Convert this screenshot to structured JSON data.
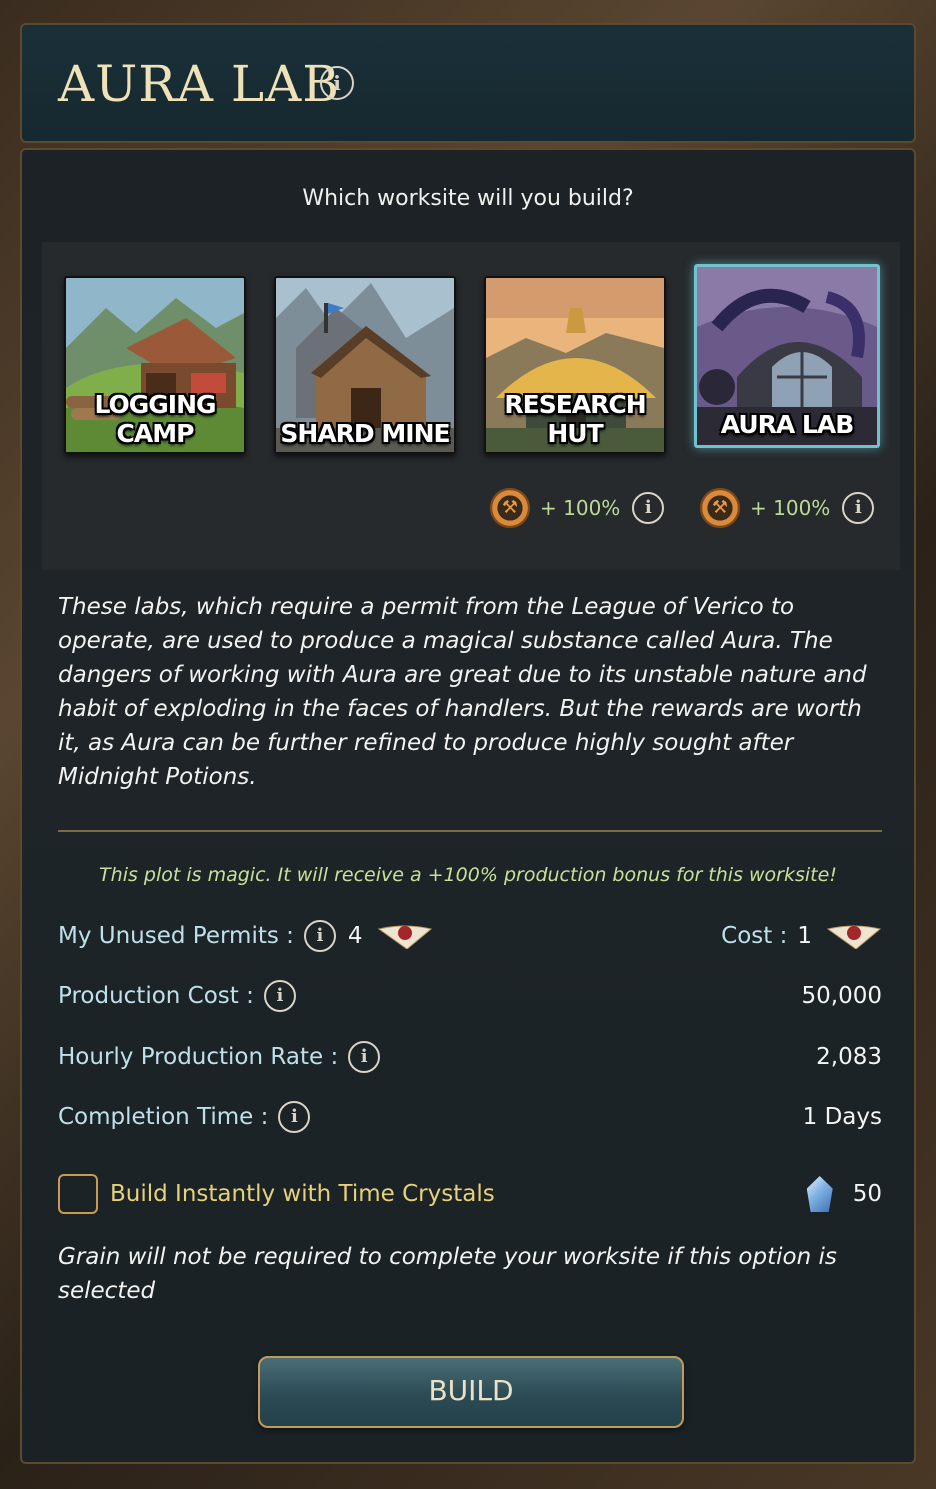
{
  "header": {
    "title": "AURA LAB"
  },
  "panel": {
    "question": "Which worksite will you build?",
    "worksites": [
      {
        "label": "LOGGING CAMP",
        "selected": false
      },
      {
        "label": "SHARD MINE",
        "selected": false
      },
      {
        "label": "RESEARCH HUT",
        "selected": false,
        "bonus": "+ 100%"
      },
      {
        "label": "AURA LAB",
        "selected": true,
        "bonus": "+ 100%"
      }
    ],
    "description": "These labs, which require a permit from the League of Verico to operate, are used to produce a magical substance called Aura. The dangers of working with Aura are great due to its unstable nature and habit of exploding in the faces of handlers. But the rewards are worth it, as Aura can be further refined to produce highly sought after Midnight Potions.",
    "magic_note": "This plot is magic. It will receive a +100% production bonus for this worksite!",
    "permits": {
      "label": "My Unused Permits :",
      "count": "4",
      "cost_label": "Cost :",
      "cost_value": "1"
    },
    "production_cost": {
      "label": "Production Cost :",
      "value": "50,000"
    },
    "hourly_rate": {
      "label": "Hourly Production Rate :",
      "value": "2,083"
    },
    "completion_time": {
      "label": "Completion Time :",
      "value": "1 Days"
    },
    "build_instantly": {
      "label": "Build Instantly with Time Crystals",
      "checked": false,
      "crystals": "50"
    },
    "grain_note": "Grain will not be required to complete your worksite if this option is selected",
    "build_button": "BUILD"
  },
  "colors": {
    "accent_gold": "#c49a5a",
    "title": "#efe2b8",
    "bonus_green": "#bcd995",
    "selected_border": "#6fc3cf"
  }
}
